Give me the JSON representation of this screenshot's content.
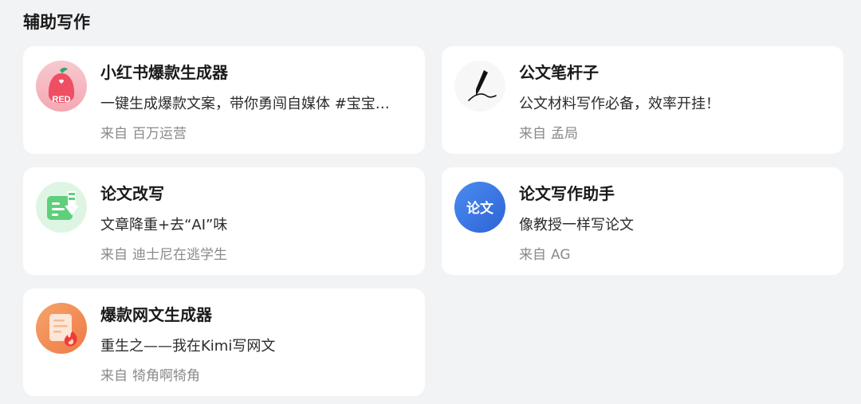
{
  "section": {
    "title": "辅助写作"
  },
  "from_label": "来自",
  "bots": [
    {
      "name": "小红书爆款生成器",
      "desc": "一键生成爆款文案，带你勇闯自媒体 #宝宝…",
      "author": "百万运营",
      "icon": "red-pepper-logo-icon",
      "icon_text": "RED",
      "icon_color": "#f0566a"
    },
    {
      "name": "公文笔杆子",
      "desc": "公文材料写作必备，效率开挂！",
      "author": "孟局",
      "icon": "fountain-pen-icon",
      "icon_color": "#111111"
    },
    {
      "name": "论文改写",
      "desc": "文章降重+去“AI”味",
      "author": "迪士尼在逃学生",
      "icon": "document-download-icon",
      "icon_color": "#5fcf7b"
    },
    {
      "name": "论文写作助手",
      "desc": "像教授一样写论文",
      "author": "AG",
      "icon": "thesis-badge-icon",
      "icon_text": "论文",
      "icon_color": "#3d7be8"
    },
    {
      "name": "爆款网文生成器",
      "desc": "重生之——我在Kimi写网文",
      "author": "犄角啊犄角",
      "icon": "flame-document-icon",
      "icon_color": "#f08a55"
    }
  ]
}
